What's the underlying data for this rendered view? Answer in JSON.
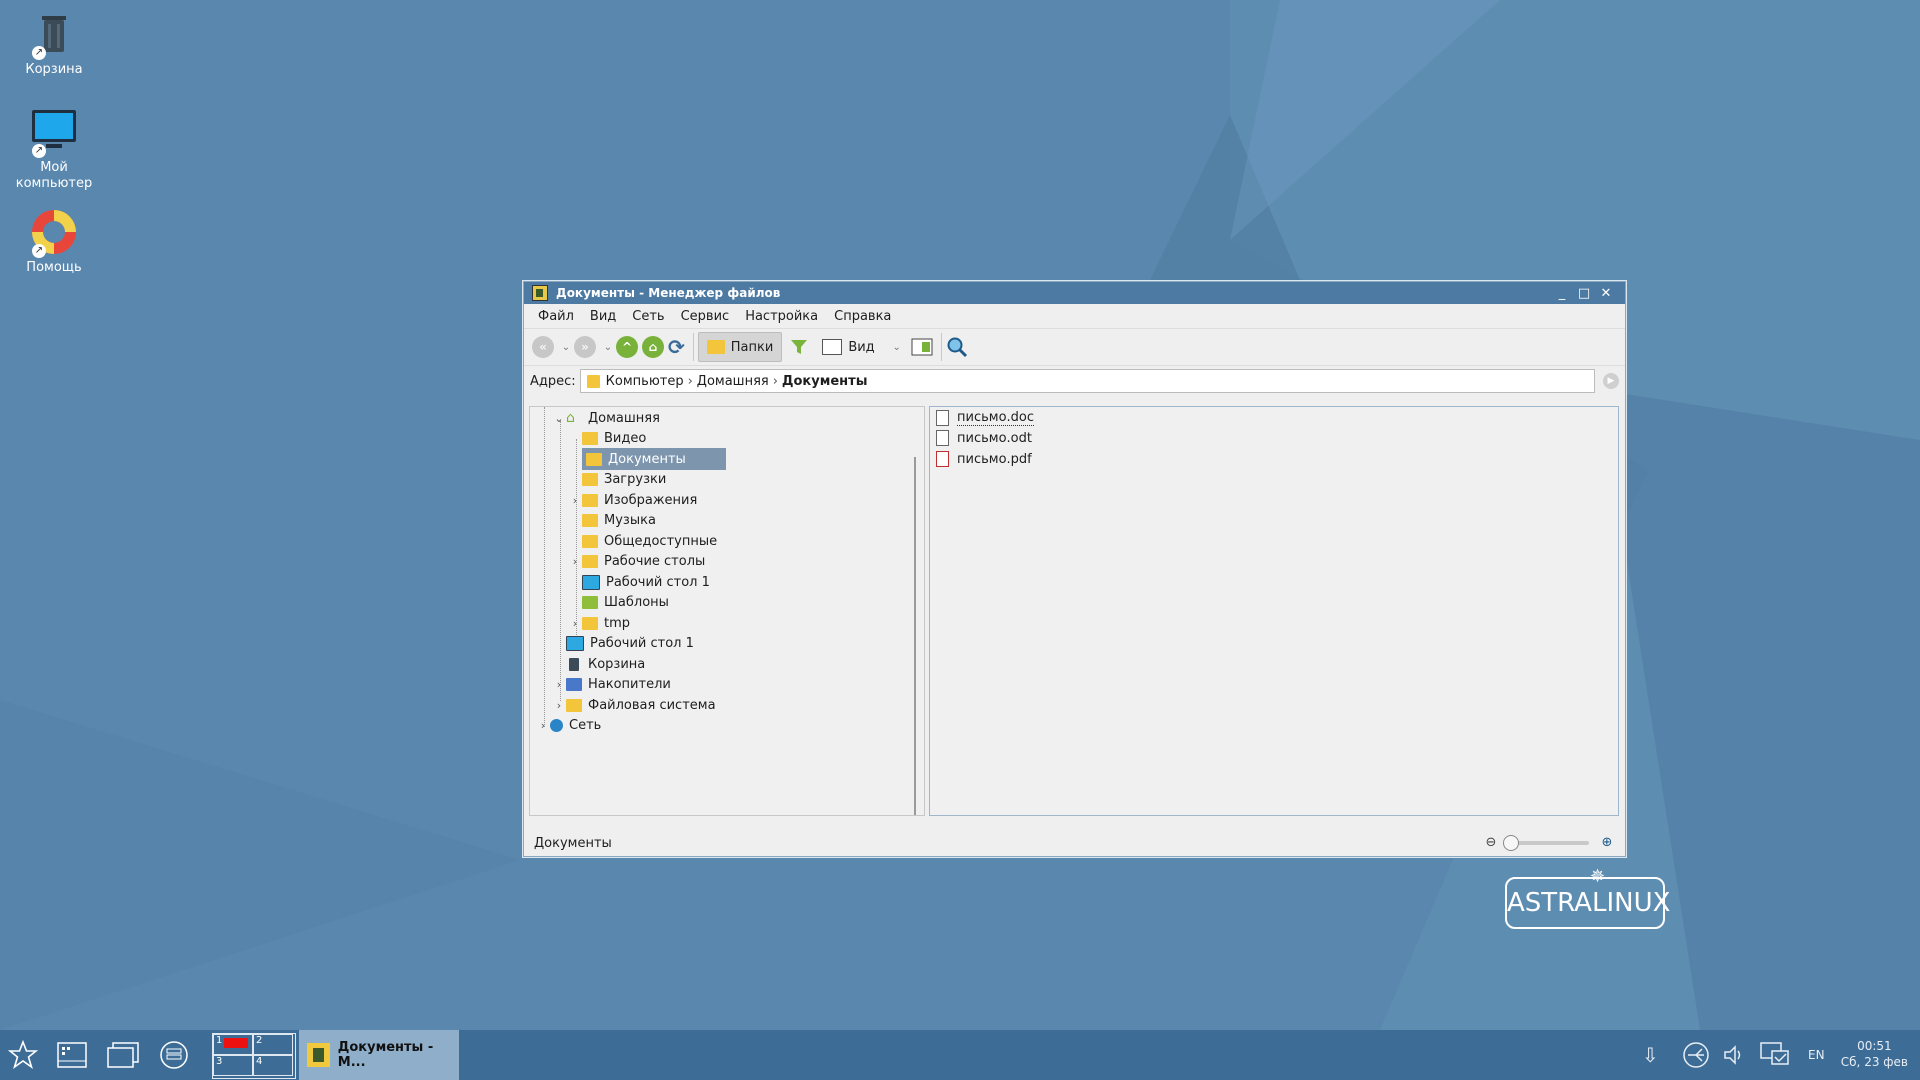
{
  "desktop": {
    "icons": [
      {
        "label": "Корзина"
      },
      {
        "label_line1": "Мой",
        "label_line2": "компьютер"
      },
      {
        "label": "Помощь"
      }
    ],
    "logo_text": "ASTRALINUX"
  },
  "window": {
    "title": "Документы - Менеджер файлов",
    "menu": [
      "Файл",
      "Вид",
      "Сеть",
      "Сервис",
      "Настройка",
      "Справка"
    ],
    "toolbar": {
      "folders_label": "Папки",
      "view_label": "Вид"
    },
    "address": {
      "label": "Адрес:",
      "crumbs": [
        "Компьютер",
        "Домашняя"
      ],
      "current": "Документы"
    },
    "tree": [
      "Домашняя",
      "Видео",
      "Документы",
      "Загрузки",
      "Изображения",
      "Музыка",
      "Общедоступные",
      "Рабочие столы",
      "Рабочий стол 1",
      "Шаблоны",
      "tmp",
      "Рабочий стол 1",
      "Корзина",
      "Накопители",
      "Файловая система",
      "Сеть"
    ],
    "files": [
      "письмо.doc",
      "письмо.odt",
      "письмо.pdf"
    ],
    "status": "Документы"
  },
  "taskbar": {
    "pager": [
      "1",
      "2",
      "3",
      "4"
    ],
    "task_label": "Документы - М...",
    "lang": "EN",
    "time": "00:51",
    "date": "Сб, 23 фев"
  },
  "colors": {
    "desktop": "#5a87ad",
    "taskbar": "#3d6d97",
    "titlebar": "#4d7aa3",
    "selection": "#7d95ad",
    "accent_green": "#79b23a",
    "folder": "#f3c53b"
  }
}
